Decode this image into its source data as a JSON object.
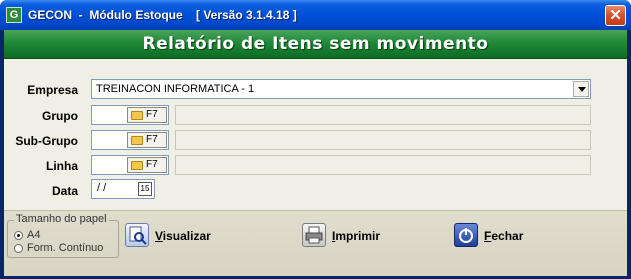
{
  "window": {
    "title": "GECON  -  Módulo Estoque    [ Versão 3.1.4.18 ]",
    "app_icon_letter": "G",
    "close_label": "✕"
  },
  "banner": {
    "title": "Relatório de Itens sem movimento"
  },
  "form": {
    "empresa": {
      "label": "Empresa",
      "value": "TREINACON INFORMATICA - 1"
    },
    "grupo": {
      "label": "Grupo",
      "button": "F7"
    },
    "subgrupo": {
      "label": "Sub-Grupo",
      "button": "F7"
    },
    "linha": {
      "label": "Linha",
      "button": "F7"
    },
    "data": {
      "label": "Data",
      "value": "/ /",
      "calendar": "15"
    }
  },
  "paper": {
    "title": "Tamanho do papel",
    "options": [
      "A4",
      "Form. Contínuo"
    ],
    "selected": "A4"
  },
  "actions": {
    "visualizar": {
      "first": "V",
      "rest": "isualizar"
    },
    "imprimir": {
      "first": "I",
      "rest": "mprimir"
    },
    "fechar": {
      "first": "F",
      "rest": "echar"
    }
  }
}
